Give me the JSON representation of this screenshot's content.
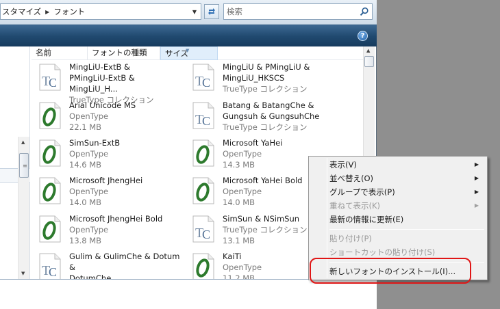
{
  "breadcrumb": {
    "parent": "スタマイズ",
    "current": "フォント"
  },
  "search": {
    "placeholder": "検索"
  },
  "columns": [
    "名前",
    "フォントの種類",
    "サイズ"
  ],
  "help_label": "?",
  "fonts": [
    {
      "name1": "MingLiU-ExtB &",
      "name2": "PMingLiU-ExtB & MingLiU_H...",
      "type": "TrueType コレクション",
      "size": "",
      "icon": "truetype-icon"
    },
    {
      "name1": "MingLiU & PMingLiU &",
      "name2": "MingLiU_HKSCS",
      "type": "TrueType コレクション",
      "size": "",
      "icon": "truetype-icon"
    },
    {
      "name1": "Arial Unicode MS",
      "name2": "",
      "type": "OpenType",
      "size": "22.1 MB",
      "icon": "opentype-icon"
    },
    {
      "name1": "Batang & BatangChe &",
      "name2": "Gungsuh & GungsuhChe",
      "type": "TrueType コレクション",
      "size": "",
      "icon": "truetype-icon"
    },
    {
      "name1": "SimSun-ExtB",
      "name2": "",
      "type": "OpenType",
      "size": "14.6 MB",
      "icon": "opentype-icon"
    },
    {
      "name1": "Microsoft YaHei",
      "name2": "",
      "type": "OpenType",
      "size": "14.3 MB",
      "icon": "opentype-icon"
    },
    {
      "name1": "Microsoft JhengHei",
      "name2": "",
      "type": "OpenType",
      "size": "14.0 MB",
      "icon": "opentype-icon"
    },
    {
      "name1": "Microsoft YaHei Bold",
      "name2": "",
      "type": "OpenType",
      "size": "14.0 MB",
      "icon": "opentype-icon"
    },
    {
      "name1": "Microsoft JhengHei Bold",
      "name2": "",
      "type": "OpenType",
      "size": "13.8 MB",
      "icon": "opentype-icon"
    },
    {
      "name1": "SimSun & NSimSun",
      "name2": "",
      "type": "TrueType コレクション",
      "size": "13.1 MB",
      "icon": "truetype-icon"
    },
    {
      "name1": "Gulim & GulimChe & Dotum &",
      "name2": "DotumChe",
      "type": "TrueType コレクション",
      "size": "",
      "icon": "truetype-icon"
    },
    {
      "name1": "KaiTi",
      "name2": "",
      "type": "OpenType",
      "size": "11.2 MB",
      "icon": "opentype-icon"
    }
  ],
  "context_menu": {
    "view": "表示(V)",
    "sort": "並べ替え(O)",
    "group": "グループで表示(P)",
    "stack": "重ねて表示(K)",
    "refresh": "最新の情報に更新(E)",
    "paste": "貼り付け(P)",
    "paste_shortcut": "ショートカットの貼り付け(S)",
    "install_font": "新しいフォントのインストール(I)..."
  },
  "colors": {
    "highlight": "#e01616",
    "command_bar": "#20496f",
    "desktop": "#8f8f8f"
  }
}
